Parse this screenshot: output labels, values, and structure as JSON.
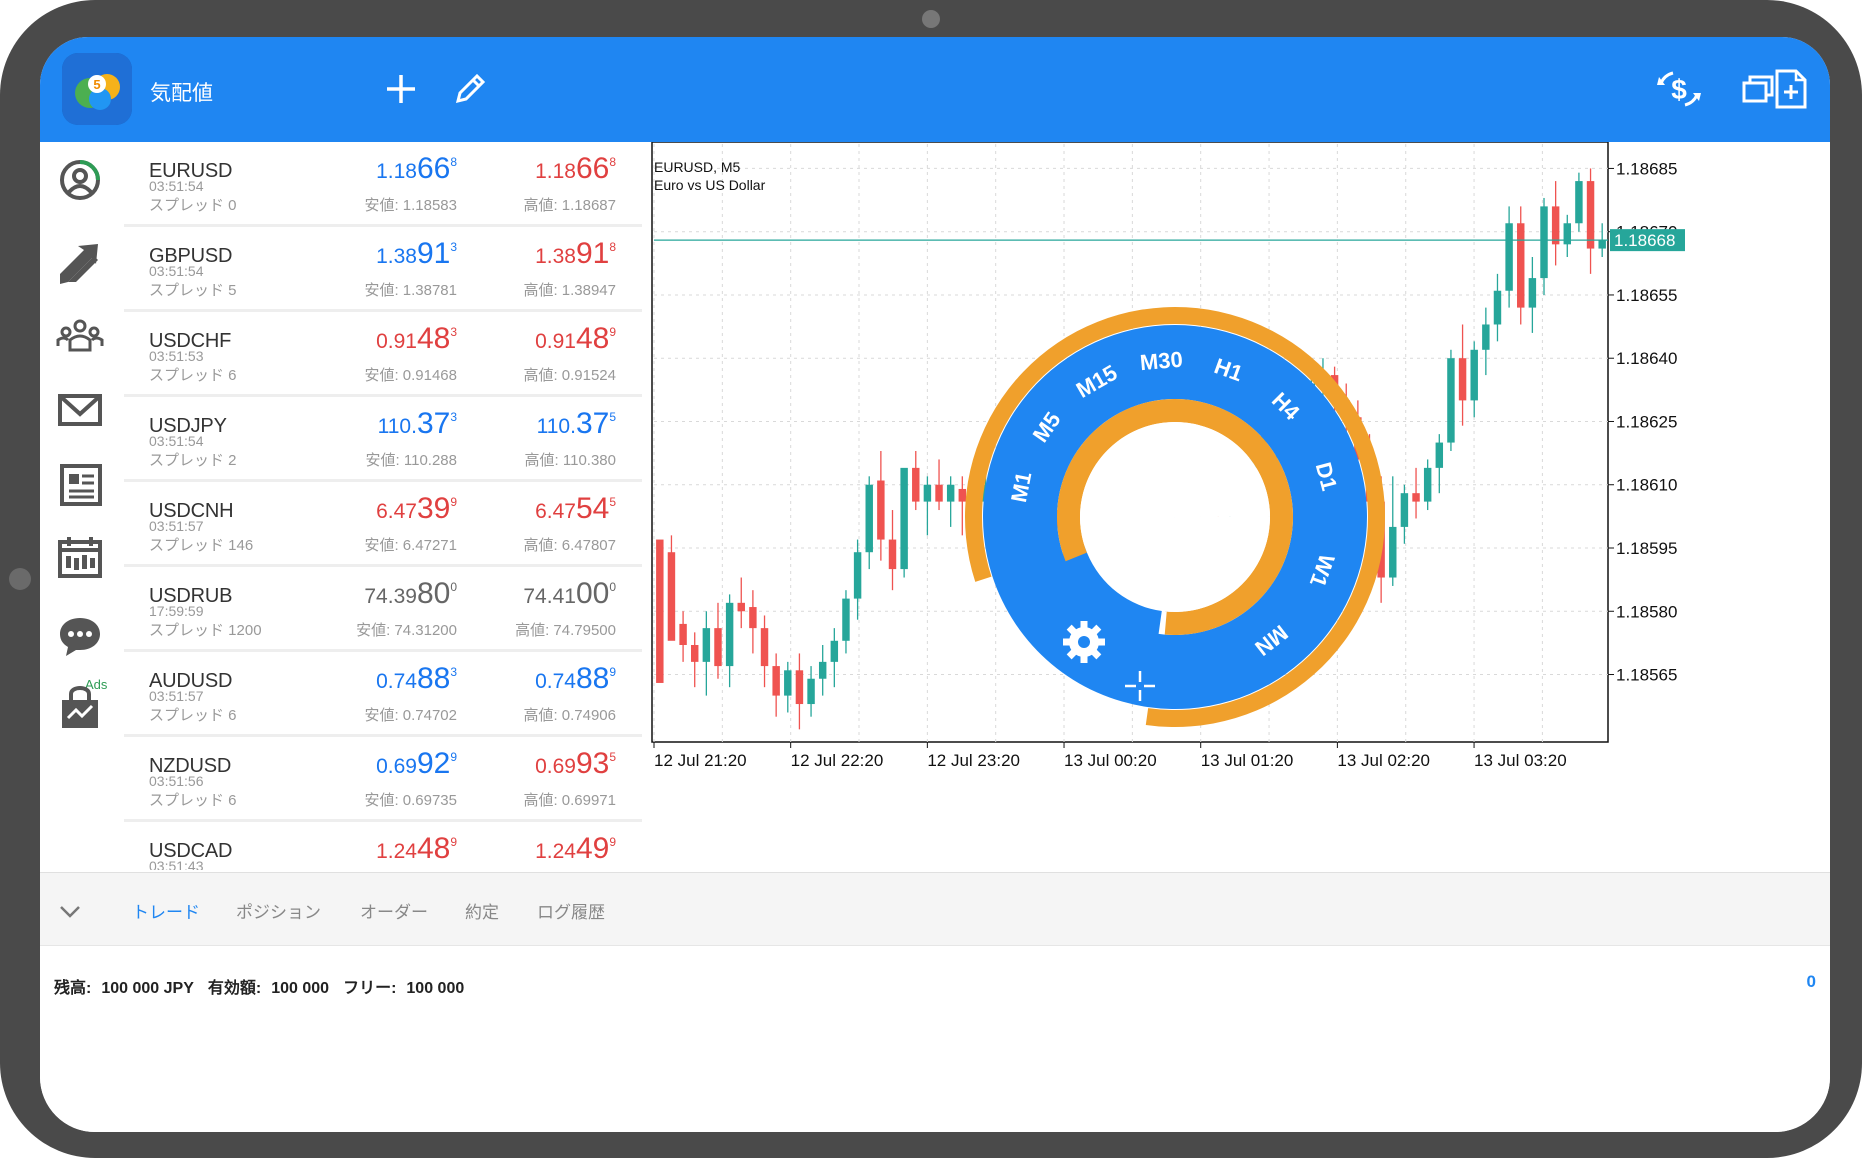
{
  "header": {
    "title": "気配値",
    "icons": [
      "add-icon",
      "edit-icon",
      "currency-exchange-icon",
      "windows-icon",
      "add-document-icon"
    ]
  },
  "nav": {
    "icons": [
      "quotes-icon",
      "trade-icon",
      "community-icon",
      "mail-icon",
      "news-icon",
      "calendar-icon",
      "chat-icon",
      "market-icon"
    ],
    "ads_label": "Ads"
  },
  "quotes": [
    {
      "symbol": "EURUSD",
      "time": "03:51:54",
      "spread": "スプレッド 0",
      "bid": {
        "pre": "1.18",
        "big": "66",
        "sup": "8",
        "color": "blue"
      },
      "ask": {
        "pre": "1.18",
        "big": "66",
        "sup": "8",
        "color": "red"
      },
      "low": "安値: 1.18583",
      "high": "高値: 1.18687"
    },
    {
      "symbol": "GBPUSD",
      "time": "03:51:54",
      "spread": "スプレッド 5",
      "bid": {
        "pre": "1.38",
        "big": "91",
        "sup": "3",
        "color": "blue"
      },
      "ask": {
        "pre": "1.38",
        "big": "91",
        "sup": "8",
        "color": "red"
      },
      "low": "安値: 1.38781",
      "high": "高値: 1.38947"
    },
    {
      "symbol": "USDCHF",
      "time": "03:51:53",
      "spread": "スプレッド 6",
      "bid": {
        "pre": "0.91",
        "big": "48",
        "sup": "3",
        "color": "red"
      },
      "ask": {
        "pre": "0.91",
        "big": "48",
        "sup": "9",
        "color": "red"
      },
      "low": "安値: 0.91468",
      "high": "高値: 0.91524"
    },
    {
      "symbol": "USDJPY",
      "time": "03:51:54",
      "spread": "スプレッド 2",
      "bid": {
        "pre": "110.",
        "big": "37",
        "sup": "3",
        "color": "blue"
      },
      "ask": {
        "pre": "110.",
        "big": "37",
        "sup": "5",
        "color": "blue"
      },
      "low": "安値: 110.288",
      "high": "高値: 110.380"
    },
    {
      "symbol": "USDCNH",
      "time": "03:51:57",
      "spread": "スプレッド 146",
      "bid": {
        "pre": "6.47",
        "big": "39",
        "sup": "9",
        "color": "red"
      },
      "ask": {
        "pre": "6.47",
        "big": "54",
        "sup": "5",
        "color": "red"
      },
      "low": "安値: 6.47271",
      "high": "高値: 6.47807"
    },
    {
      "symbol": "USDRUB",
      "time": "17:59:59",
      "spread": "スプレッド 1200",
      "bid": {
        "pre": "74.39",
        "big": "80",
        "sup": "0",
        "color": "grey"
      },
      "ask": {
        "pre": "74.41",
        "big": "00",
        "sup": "0",
        "color": "grey"
      },
      "low": "安値: 74.31200",
      "high": "高値: 74.79500"
    },
    {
      "symbol": "AUDUSD",
      "time": "03:51:57",
      "spread": "スプレッド 6",
      "bid": {
        "pre": "0.74",
        "big": "88",
        "sup": "3",
        "color": "blue"
      },
      "ask": {
        "pre": "0.74",
        "big": "88",
        "sup": "9",
        "color": "blue"
      },
      "low": "安値: 0.74702",
      "high": "高値: 0.74906"
    },
    {
      "symbol": "NZDUSD",
      "time": "03:51:56",
      "spread": "スプレッド 6",
      "bid": {
        "pre": "0.69",
        "big": "92",
        "sup": "9",
        "color": "blue"
      },
      "ask": {
        "pre": "0.69",
        "big": "93",
        "sup": "5",
        "color": "red"
      },
      "low": "安値: 0.69735",
      "high": "高値: 0.69971"
    },
    {
      "symbol": "USDCAD",
      "time": "03:51:43",
      "spread": "",
      "bid": {
        "pre": "1.24",
        "big": "48",
        "sup": "9",
        "color": "red"
      },
      "ask": {
        "pre": "1.24",
        "big": "49",
        "sup": "9",
        "color": "red"
      },
      "low": "",
      "high": ""
    }
  ],
  "chart": {
    "symbol_label": "EURUSD, M5",
    "description": "Euro vs US Dollar",
    "current_price": "1.18668"
  },
  "chart_data": {
    "type": "candlestick",
    "y_ticks": [
      "1.18685",
      "1.18670",
      "1.18655",
      "1.18640",
      "1.18625",
      "1.18610",
      "1.18595",
      "1.18580",
      "1.18565"
    ],
    "ylim": [
      1.18549,
      1.18687
    ],
    "x_ticks": [
      "12 Jul 21:20",
      "12 Jul 22:20",
      "12 Jul 23:20",
      "13 Jul 00:20",
      "13 Jul 01:20",
      "13 Jul 02:20",
      "13 Jul 03:20"
    ],
    "current_price": 1.18668,
    "grid": true,
    "up_color": "#26a69a",
    "down_color": "#ef5350",
    "candles": [
      [
        1.18597,
        1.18592,
        1.18575,
        1.18563
      ],
      [
        1.18594,
        1.18598,
        1.1858,
        1.18573
      ],
      [
        1.18577,
        1.1858,
        1.18568,
        1.18572
      ],
      [
        1.18572,
        1.18575,
        1.18562,
        1.18568
      ],
      [
        1.18568,
        1.1858,
        1.1856,
        1.18576
      ],
      [
        1.18576,
        1.18582,
        1.18564,
        1.18567
      ],
      [
        1.18567,
        1.18584,
        1.18562,
        1.18582
      ],
      [
        1.18582,
        1.18588,
        1.18576,
        1.1858
      ],
      [
        1.18581,
        1.18585,
        1.1857,
        1.18576
      ],
      [
        1.18576,
        1.18579,
        1.18562,
        1.18567
      ],
      [
        1.18567,
        1.1857,
        1.18555,
        1.1856
      ],
      [
        1.1856,
        1.18568,
        1.18556,
        1.18566
      ],
      [
        1.18566,
        1.1857,
        1.18552,
        1.18558
      ],
      [
        1.18558,
        1.18567,
        1.18555,
        1.18564
      ],
      [
        1.18564,
        1.18572,
        1.1856,
        1.18568
      ],
      [
        1.18568,
        1.18576,
        1.18562,
        1.18573
      ],
      [
        1.18573,
        1.18585,
        1.1857,
        1.18583
      ],
      [
        1.18583,
        1.18597,
        1.18578,
        1.18594
      ],
      [
        1.18594,
        1.18612,
        1.1859,
        1.1861
      ],
      [
        1.18611,
        1.18618,
        1.18592,
        1.18597
      ],
      [
        1.18597,
        1.18604,
        1.18585,
        1.1859
      ],
      [
        1.1859,
        1.18612,
        1.18588,
        1.18614
      ],
      [
        1.18614,
        1.18618,
        1.18604,
        1.18606
      ],
      [
        1.18606,
        1.18612,
        1.18598,
        1.1861
      ],
      [
        1.1861,
        1.18616,
        1.18604,
        1.18606
      ],
      [
        1.18606,
        1.18612,
        1.186,
        1.1861
      ],
      [
        1.18609,
        1.18612,
        1.18598,
        1.18606
      ],
      [
        1.18606,
        1.1861,
        1.186,
        1.18609
      ],
      [
        1.18606,
        1.18614,
        1.18602,
        1.1861
      ],
      [
        1.1861,
        1.18616,
        1.18604,
        1.18612
      ],
      [
        1.18612,
        1.18614,
        1.18596,
        1.18598
      ],
      [
        1.18598,
        1.18604,
        1.18594,
        1.186
      ],
      [
        1.186,
        1.18606,
        1.18596,
        1.18602
      ],
      [
        1.18602,
        1.18608,
        1.18598,
        1.18604
      ],
      [
        1.18604,
        1.1861,
        1.18596,
        1.186
      ],
      [
        1.186,
        1.18606,
        1.18592,
        1.18596
      ],
      [
        1.18596,
        1.186,
        1.18588,
        1.18592
      ],
      [
        1.18592,
        1.18604,
        1.18588,
        1.18602
      ],
      [
        1.18602,
        1.18608,
        1.18596,
        1.18598
      ],
      [
        1.18598,
        1.18602,
        1.1859,
        1.18594
      ],
      [
        1.18594,
        1.18602,
        1.1859,
        1.18598
      ],
      [
        1.18598,
        1.18606,
        1.18594,
        1.18604
      ],
      [
        1.18604,
        1.1861,
        1.18596,
        1.18608
      ],
      [
        1.18608,
        1.18614,
        1.18602,
        1.18612
      ],
      [
        1.18612,
        1.18618,
        1.18604,
        1.1861
      ],
      [
        1.1861,
        1.18616,
        1.18606,
        1.18612
      ],
      [
        1.18612,
        1.18618,
        1.18606,
        1.18614
      ],
      [
        1.18614,
        1.1862,
        1.18608,
        1.18616
      ],
      [
        1.18616,
        1.1862,
        1.18602,
        1.18606
      ],
      [
        1.18606,
        1.18614,
        1.18602,
        1.18612
      ],
      [
        1.18612,
        1.18618,
        1.18606,
        1.18614
      ],
      [
        1.18614,
        1.18622,
        1.18608,
        1.1862
      ],
      [
        1.1862,
        1.18626,
        1.18614,
        1.18624
      ],
      [
        1.18624,
        1.1863,
        1.18616,
        1.18628
      ],
      [
        1.18628,
        1.18634,
        1.1862,
        1.1863
      ],
      [
        1.1863,
        1.18636,
        1.18624,
        1.18632
      ],
      [
        1.18632,
        1.18638,
        1.18626,
        1.18634
      ],
      [
        1.18634,
        1.1864,
        1.18628,
        1.18636
      ],
      [
        1.18636,
        1.18638,
        1.18626,
        1.1863
      ],
      [
        1.1863,
        1.18634,
        1.18622,
        1.18626
      ],
      [
        1.18626,
        1.1863,
        1.18612,
        1.18616
      ],
      [
        1.18616,
        1.18622,
        1.18602,
        1.18606
      ],
      [
        1.18606,
        1.18612,
        1.18582,
        1.18588
      ],
      [
        1.18588,
        1.18612,
        1.18586,
        1.186
      ],
      [
        1.186,
        1.1861,
        1.18596,
        1.18608
      ],
      [
        1.18608,
        1.18614,
        1.18602,
        1.18606
      ],
      [
        1.18606,
        1.18616,
        1.18604,
        1.18614
      ],
      [
        1.18614,
        1.18622,
        1.18608,
        1.1862
      ],
      [
        1.1862,
        1.18642,
        1.18618,
        1.1864
      ],
      [
        1.1864,
        1.18648,
        1.18624,
        1.1863
      ],
      [
        1.1863,
        1.18644,
        1.18626,
        1.18642
      ],
      [
        1.18642,
        1.18652,
        1.18636,
        1.18648
      ],
      [
        1.18648,
        1.1866,
        1.18644,
        1.18656
      ],
      [
        1.18656,
        1.18676,
        1.18652,
        1.18672
      ],
      [
        1.18672,
        1.18676,
        1.18648,
        1.18652
      ],
      [
        1.18652,
        1.18664,
        1.18646,
        1.18659
      ],
      [
        1.18659,
        1.18678,
        1.18655,
        1.18676
      ],
      [
        1.18676,
        1.18682,
        1.18662,
        1.18667
      ],
      [
        1.18667,
        1.18674,
        1.18664,
        1.18672
      ],
      [
        1.18672,
        1.18684,
        1.1867,
        1.18682
      ],
      [
        1.18682,
        1.18685,
        1.1866,
        1.18666
      ],
      [
        1.18666,
        1.18672,
        1.18664,
        1.18668
      ]
    ]
  },
  "timeframes": [
    "M1",
    "M5",
    "M15",
    "M30",
    "H1",
    "H4",
    "D1",
    "W1",
    "MN"
  ],
  "bottom": {
    "tabs": [
      "トレード",
      "ポジション",
      "オーダー",
      "約定",
      "ログ履歴"
    ],
    "active_tab": "トレード",
    "balance_label": "残高:",
    "balance_value": "100 000 JPY",
    "equity_label": "有効額:",
    "equity_value": "100 000",
    "free_label": "フリー:",
    "free_value": "100 000",
    "right_value": "0"
  },
  "colors": {
    "accent": "#1f86f2",
    "orange": "#f0a02c",
    "bid_blue": "#1976f0",
    "ask_red": "#e04040"
  }
}
